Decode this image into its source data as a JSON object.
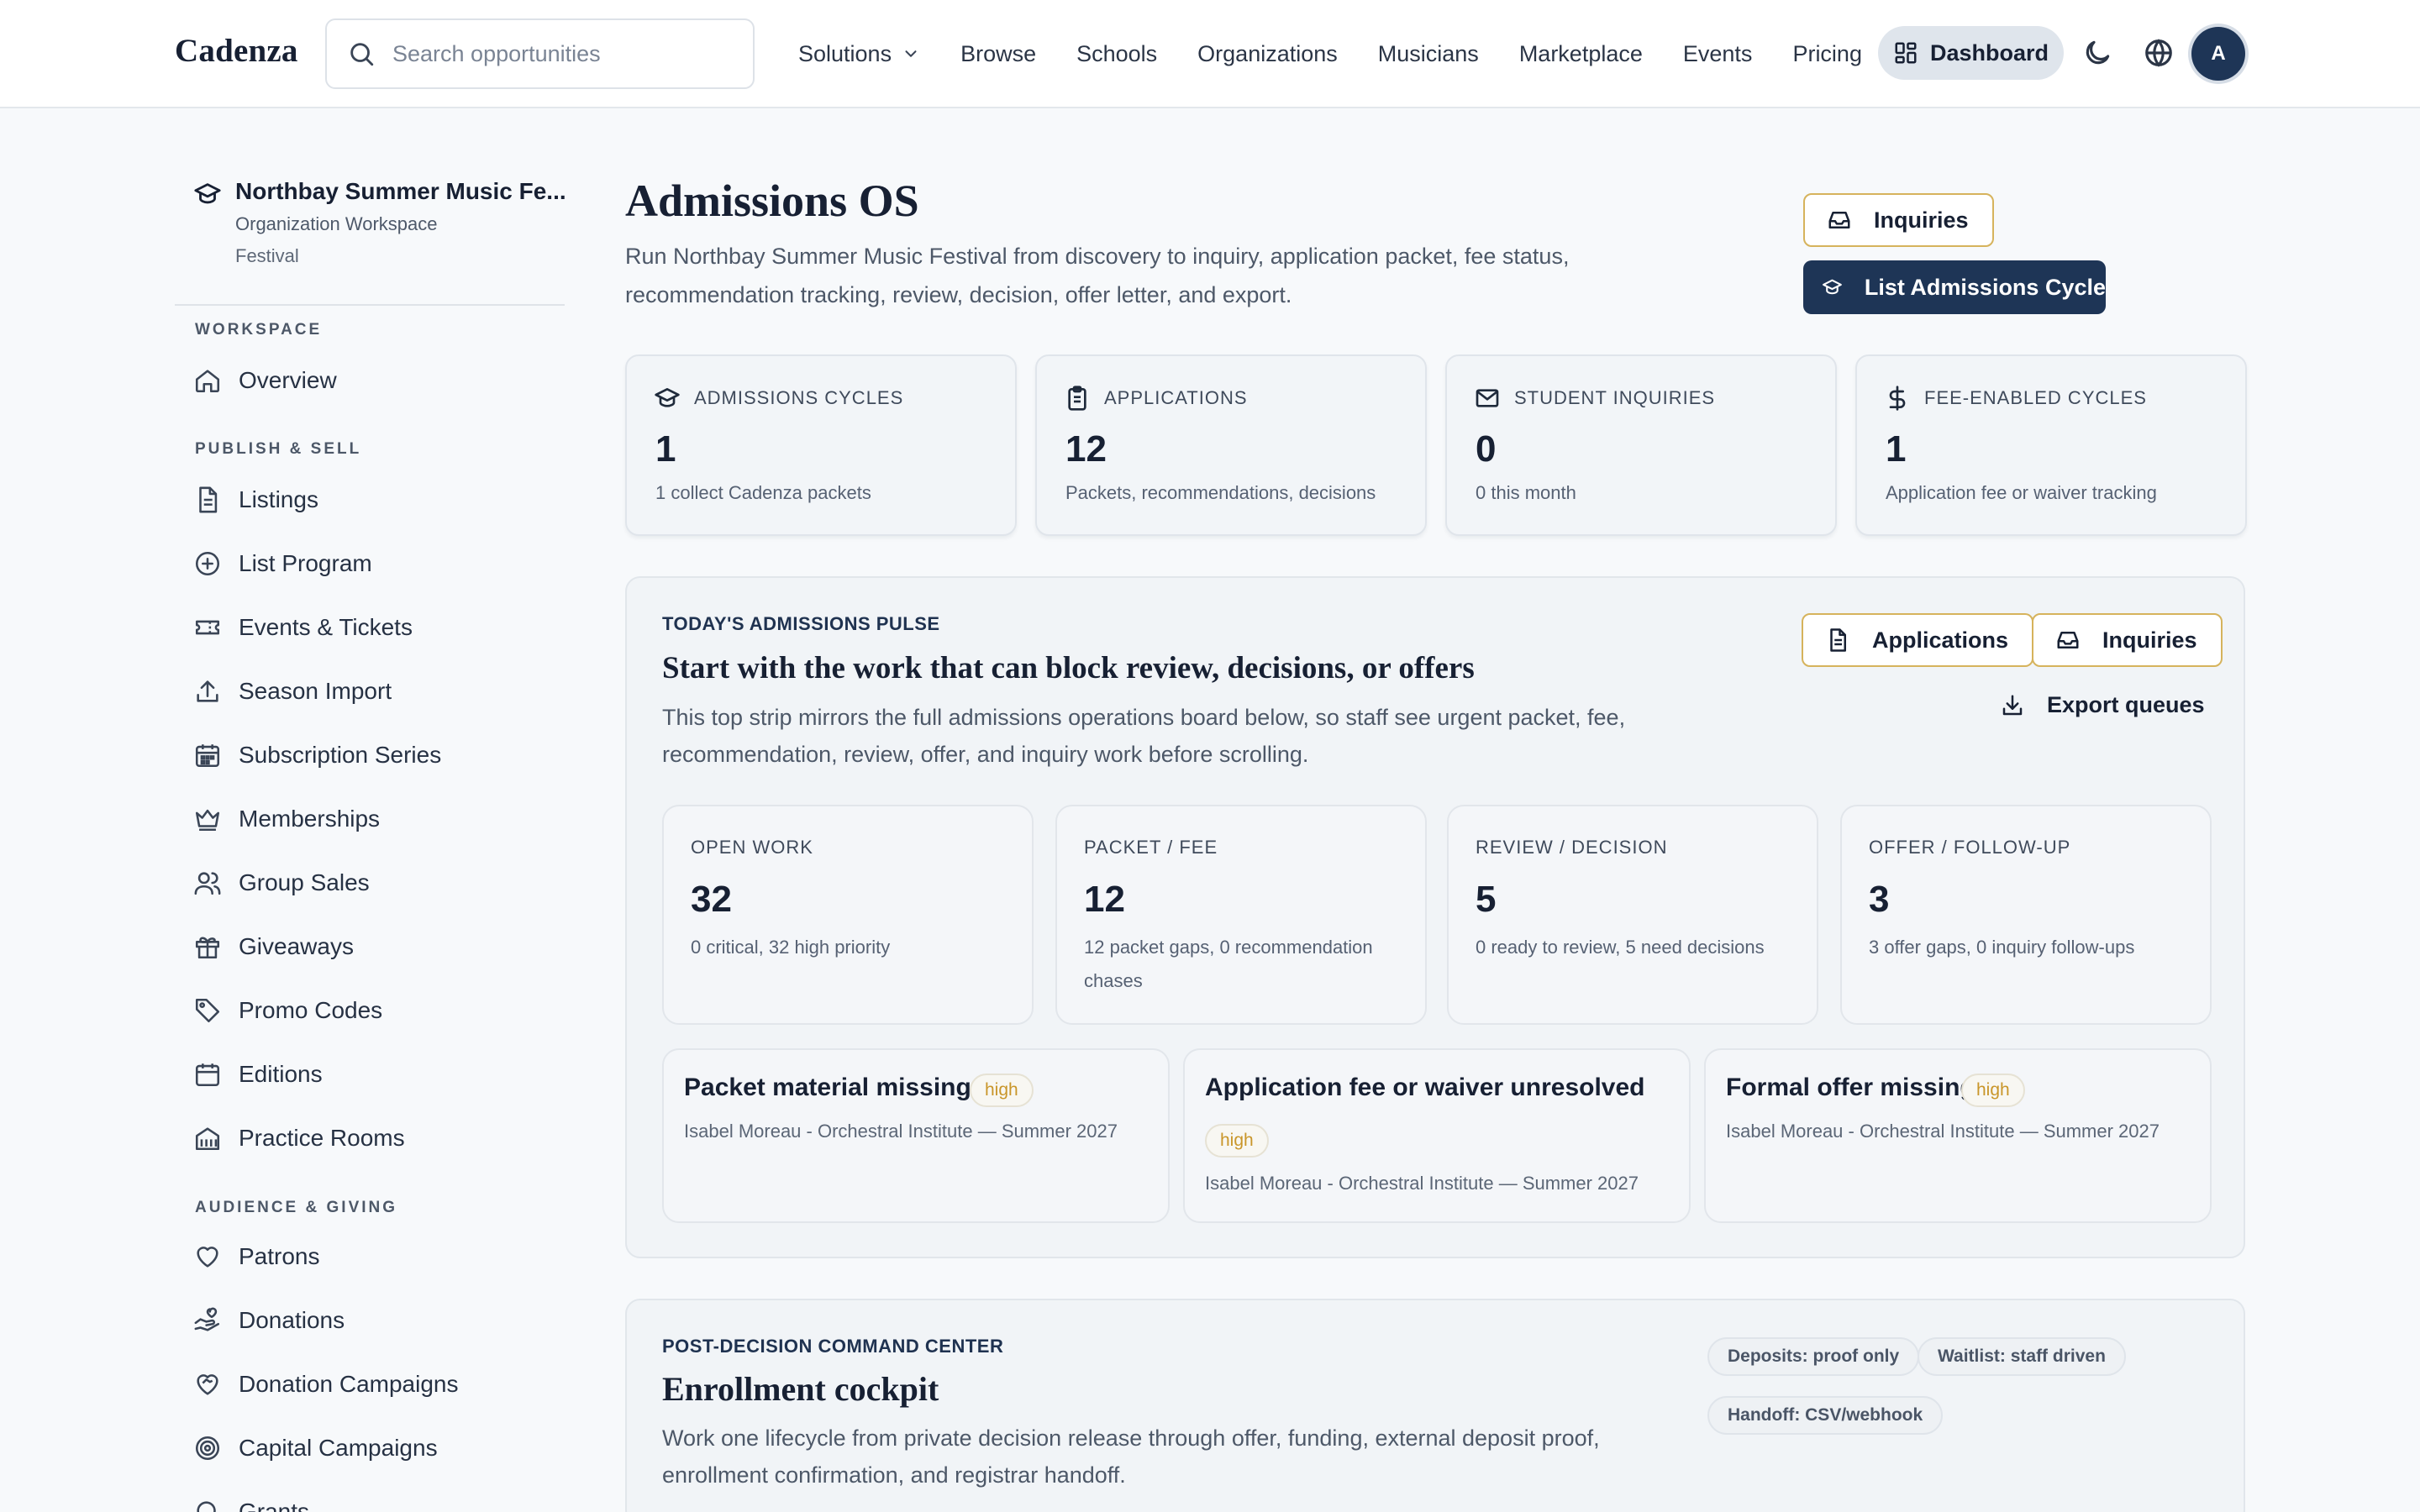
{
  "topbar": {
    "brand": "Cadenza",
    "search_placeholder": "Search opportunities",
    "nav": [
      {
        "label": "Solutions"
      },
      {
        "label": "Browse"
      },
      {
        "label": "Schools"
      },
      {
        "label": "Organizations"
      },
      {
        "label": "Musicians"
      },
      {
        "label": "Marketplace"
      },
      {
        "label": "Events"
      },
      {
        "label": "Pricing"
      }
    ],
    "dashboard_label": "Dashboard",
    "avatar_initial": "A"
  },
  "sidebar": {
    "org_name": "Northbay Summer Music Fe...",
    "org_subtitle": "Organization Workspace",
    "org_type": "Festival",
    "sections": [
      {
        "label": "WORKSPACE"
      },
      {
        "label": "PUBLISH & SELL"
      },
      {
        "label": "AUDIENCE & GIVING"
      }
    ],
    "items": [
      {
        "label": "Overview",
        "icon": "home-icon"
      },
      {
        "label": "Listings",
        "icon": "document-icon"
      },
      {
        "label": "List Program",
        "icon": "plus-circle-icon"
      },
      {
        "label": "Events & Tickets",
        "icon": "ticket-icon"
      },
      {
        "label": "Season Import",
        "icon": "upload-icon"
      },
      {
        "label": "Subscription Series",
        "icon": "calendar-grid-icon"
      },
      {
        "label": "Memberships",
        "icon": "crown-icon"
      },
      {
        "label": "Group Sales",
        "icon": "users-icon"
      },
      {
        "label": "Giveaways",
        "icon": "gift-icon"
      },
      {
        "label": "Promo Codes",
        "icon": "tag-icon"
      },
      {
        "label": "Editions",
        "icon": "calendar-icon"
      },
      {
        "label": "Practice Rooms",
        "icon": "building-icon"
      },
      {
        "label": "Patrons",
        "icon": "heart-icon"
      },
      {
        "label": "Donations",
        "icon": "hand-heart-icon"
      },
      {
        "label": "Donation Campaigns",
        "icon": "heart-handshake-icon"
      },
      {
        "label": "Capital Campaigns",
        "icon": "target-icon"
      },
      {
        "label": "Grants",
        "icon": "search-icon"
      }
    ]
  },
  "header": {
    "title": "Admissions OS",
    "description": "Run Northbay Summer Music Festival from discovery to inquiry, application packet, fee status, recommendation tracking, review, decision, offer letter, and export.",
    "inquiries_label": "Inquiries",
    "list_cycle_label": "List Admissions Cycle"
  },
  "stats": [
    {
      "label": "ADMISSIONS CYCLES",
      "value": "1",
      "sub": "1 collect Cadenza packets",
      "icon": "graduation-cap-icon"
    },
    {
      "label": "APPLICATIONS",
      "value": "12",
      "sub": "Packets, recommendations, decisions",
      "icon": "clipboard-icon"
    },
    {
      "label": "STUDENT INQUIRIES",
      "value": "0",
      "sub": "0 this month",
      "icon": "mail-icon"
    },
    {
      "label": "FEE-ENABLED CYCLES",
      "value": "1",
      "sub": "Application fee or waiver tracking",
      "icon": "dollar-icon"
    }
  ],
  "pulse": {
    "eyebrow": "TODAY'S ADMISSIONS PULSE",
    "title": "Start with the work that can block review, decisions, or offers",
    "description": "This top strip mirrors the full admissions operations board below, so staff see urgent packet, fee, recommendation, review, offer, and inquiry work before scrolling.",
    "applications_label": "Applications",
    "inquiries_label": "Inquiries",
    "export_label": "Export queues",
    "metrics": [
      {
        "label": "OPEN WORK",
        "value": "32",
        "sub": "0 critical, 32 high priority"
      },
      {
        "label": "PACKET / FEE",
        "value": "12",
        "sub": "12 packet gaps, 0 recommendation chases"
      },
      {
        "label": "REVIEW / DECISION",
        "value": "5",
        "sub": "0 ready to review, 5 need decisions"
      },
      {
        "label": "OFFER / FOLLOW-UP",
        "value": "3",
        "sub": "3 offer gaps, 0 inquiry follow-ups"
      }
    ],
    "tasks": [
      {
        "title": "Packet material missing",
        "priority": "high",
        "detail": "Isabel Moreau - Orchestral Institute — Summer 2027"
      },
      {
        "title": "Application fee or waiver unresolved",
        "priority": "high",
        "detail": "Isabel Moreau - Orchestral Institute — Summer 2027"
      },
      {
        "title": "Formal offer missing",
        "priority": "high",
        "detail": "Isabel Moreau - Orchestral Institute — Summer 2027"
      }
    ]
  },
  "enrollment": {
    "eyebrow": "POST-DECISION COMMAND CENTER",
    "title": "Enrollment cockpit",
    "description": "Work one lifecycle from private decision release through offer, funding, external deposit proof, enrollment confirmation, and registrar handoff.",
    "chips": [
      {
        "label": "Deposits: proof only"
      },
      {
        "label": "Waitlist: staff driven"
      },
      {
        "label": "Handoff: CSV/webhook"
      }
    ]
  },
  "colors": {
    "navy": "#1e3556",
    "gold_outline": "#d6b35c",
    "priority_text": "#c9962a",
    "page_bg": "#f7f9fb"
  }
}
